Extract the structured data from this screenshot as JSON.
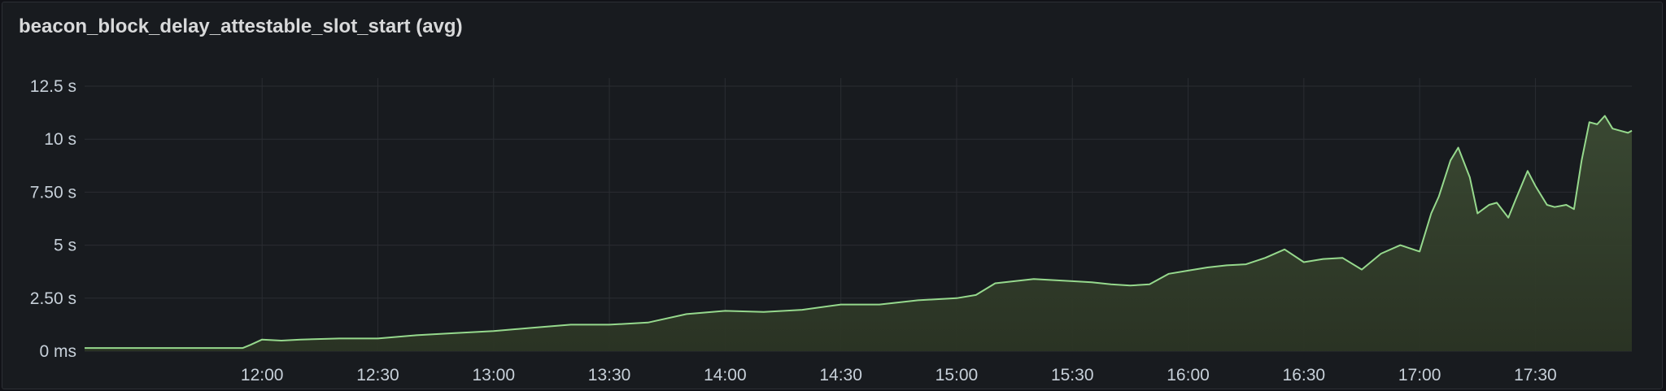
{
  "panel": {
    "title": "beacon_block_delay_attestable_slot_start (avg)"
  },
  "chart_data": {
    "type": "area",
    "title": "beacon_block_delay_attestable_slot_start (avg)",
    "xlabel": "",
    "ylabel": "",
    "x_unit": "minutes since midnight",
    "xlim": [
      "11:14",
      "17:55"
    ],
    "ylim": [
      0,
      12.5
    ],
    "y_unit": "s",
    "grid": true,
    "legend": "none",
    "line_color": "#96d98d",
    "fill_color": "#2f3a2a",
    "x_ticks": [
      "12:00",
      "12:30",
      "13:00",
      "13:30",
      "14:00",
      "14:30",
      "15:00",
      "15:30",
      "16:00",
      "16:30",
      "17:00",
      "17:30"
    ],
    "y_ticks": [
      {
        "value": 0,
        "label": "0 ms"
      },
      {
        "value": 2.5,
        "label": "2.50 s"
      },
      {
        "value": 5,
        "label": "5 s"
      },
      {
        "value": 7.5,
        "label": "7.50 s"
      },
      {
        "value": 10,
        "label": "10 s"
      },
      {
        "value": 12.5,
        "label": "12.5 s"
      }
    ],
    "series": [
      {
        "x": [
          "11:14",
          "11:20",
          "11:30",
          "11:40",
          "11:50",
          "11:55",
          "11:57",
          "12:00",
          "12:05",
          "12:10",
          "12:20",
          "12:30",
          "12:40",
          "12:50",
          "13:00",
          "13:10",
          "13:20",
          "13:30",
          "13:40",
          "13:50",
          "14:00",
          "14:10",
          "14:20",
          "14:30",
          "14:40",
          "14:50",
          "15:00",
          "15:05",
          "15:10",
          "15:20",
          "15:30",
          "15:35",
          "15:40",
          "15:45",
          "15:50",
          "15:55",
          "16:00",
          "16:05",
          "16:10",
          "16:15",
          "16:20",
          "16:25",
          "16:30",
          "16:35",
          "16:40",
          "16:45",
          "16:50",
          "16:55",
          "17:00",
          "17:03",
          "17:05",
          "17:08",
          "17:10",
          "17:13",
          "17:15",
          "17:18",
          "17:20",
          "17:23",
          "17:25",
          "17:28",
          "17:30",
          "17:33",
          "17:35",
          "17:38",
          "17:40",
          "17:42",
          "17:44",
          "17:46",
          "17:48",
          "17:50",
          "17:52",
          "17:54",
          "17:55"
        ],
        "values": [
          0.15,
          0.15,
          0.15,
          0.15,
          0.15,
          0.15,
          0.3,
          0.55,
          0.5,
          0.55,
          0.6,
          0.6,
          0.75,
          0.85,
          0.95,
          1.1,
          1.25,
          1.25,
          1.35,
          1.75,
          1.9,
          1.85,
          1.95,
          2.2,
          2.2,
          2.4,
          2.5,
          2.65,
          3.2,
          3.4,
          3.3,
          3.25,
          3.15,
          3.1,
          3.15,
          3.65,
          3.8,
          3.95,
          4.05,
          4.1,
          4.4,
          4.8,
          4.2,
          4.35,
          4.4,
          3.85,
          4.6,
          5.0,
          4.7,
          6.5,
          7.3,
          9.0,
          9.6,
          8.2,
          6.5,
          6.9,
          7.0,
          6.3,
          7.2,
          8.5,
          7.8,
          6.9,
          6.8,
          6.9,
          6.7,
          9.0,
          10.8,
          10.7,
          11.1,
          10.5,
          10.4,
          10.3,
          10.4
        ]
      }
    ]
  }
}
